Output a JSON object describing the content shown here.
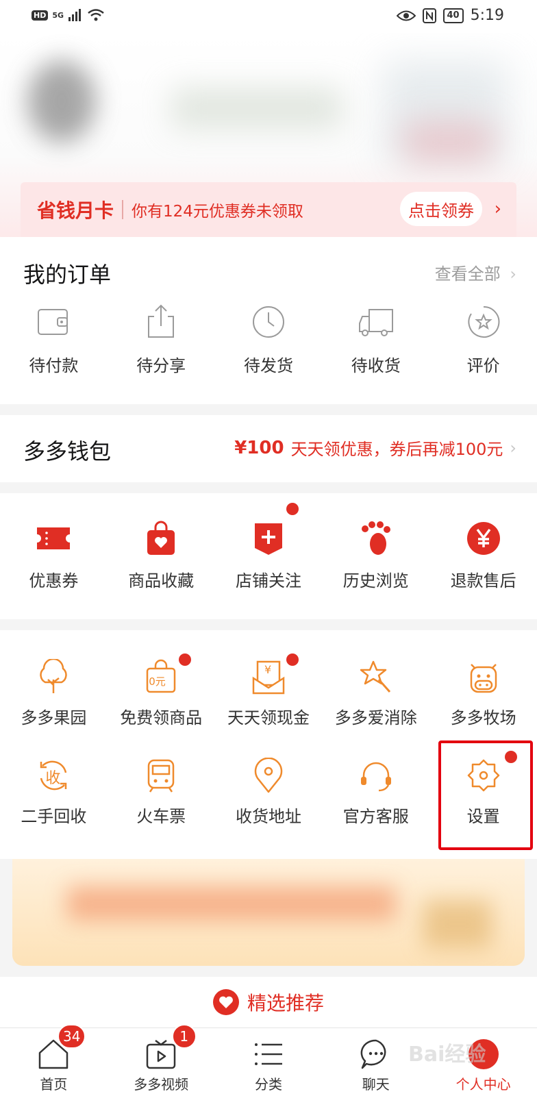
{
  "status_bar": {
    "hd": "HD",
    "net": "5G",
    "battery": "40",
    "time": "5:19"
  },
  "banner": {
    "title": "省钱月卡",
    "text": "你有124元优惠券未领取",
    "button": "点击领券"
  },
  "orders": {
    "title": "我的订单",
    "more": "查看全部",
    "items": [
      {
        "label": "待付款",
        "icon": "wallet-icon"
      },
      {
        "label": "待分享",
        "icon": "share-icon"
      },
      {
        "label": "待发货",
        "icon": "clock-icon"
      },
      {
        "label": "待收货",
        "icon": "truck-icon"
      },
      {
        "label": "评价",
        "icon": "star-icon"
      }
    ]
  },
  "wallet": {
    "title": "多多钱包",
    "price": "¥100",
    "promo": "天天领优惠，券后再减100元"
  },
  "services": {
    "items": [
      {
        "label": "优惠券",
        "icon": "coupon-icon"
      },
      {
        "label": "商品收藏",
        "icon": "bag-heart-icon"
      },
      {
        "label": "店铺关注",
        "icon": "shop-plus-icon"
      },
      {
        "label": "历史浏览",
        "icon": "footprint-icon"
      },
      {
        "label": "退款售后",
        "icon": "yen-icon"
      }
    ]
  },
  "tools": {
    "row1": [
      {
        "label": "多多果园",
        "icon": "tree-icon"
      },
      {
        "label": "免费领商品",
        "icon": "free-bag-icon"
      },
      {
        "label": "天天领现金",
        "icon": "cash-envelope-icon"
      },
      {
        "label": "多多爱消除",
        "icon": "magic-star-icon"
      },
      {
        "label": "多多牧场",
        "icon": "cow-icon"
      }
    ],
    "row1_free_label": "0元",
    "row1_cash_label": "¥",
    "row2": [
      {
        "label": "二手回收",
        "icon": "recycle-icon"
      },
      {
        "label": "火车票",
        "icon": "train-icon"
      },
      {
        "label": "收货地址",
        "icon": "location-icon"
      },
      {
        "label": "官方客服",
        "icon": "headset-icon"
      },
      {
        "label": "设置",
        "icon": "gear-icon"
      }
    ],
    "recycle_label": "收"
  },
  "recommend": {
    "title": "精选推荐"
  },
  "tabbar": {
    "items": [
      {
        "label": "首页",
        "badge": "34"
      },
      {
        "label": "多多视频",
        "badge": "1"
      },
      {
        "label": "分类"
      },
      {
        "label": "聊天"
      },
      {
        "label": "个人中心"
      }
    ]
  },
  "watermark": "Bai经验",
  "colors": {
    "accent": "#e02e24",
    "orange": "#ef8a2c",
    "highlight": "#e3000f"
  }
}
